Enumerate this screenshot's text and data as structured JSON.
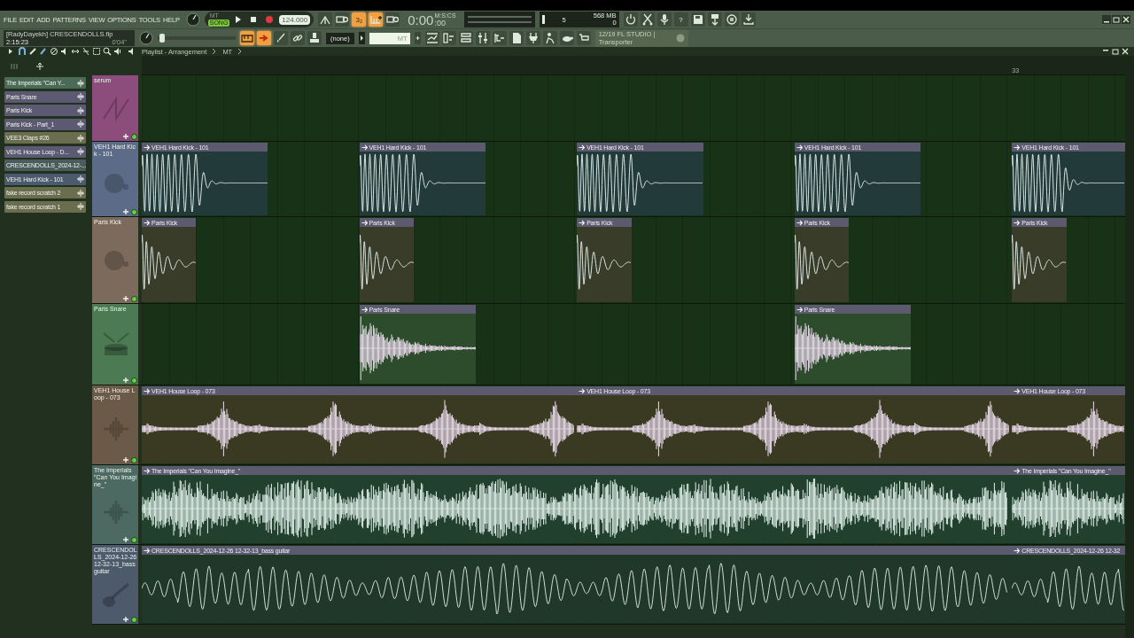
{
  "menu": [
    "FILE",
    "EDIT",
    "ADD",
    "PATTERNS",
    "VIEW",
    "OPTIONS",
    "TOOLS",
    "HELP"
  ],
  "transport": {
    "modes": [
      {
        "label": "MT",
        "selected": false
      },
      {
        "label": "SONG",
        "selected": true
      }
    ],
    "tempo": "124.000"
  },
  "tools_row1": [
    {
      "kind": "metronome",
      "on": false
    },
    {
      "kind": "wait",
      "on": false
    },
    {
      "kind": "countdown",
      "label": "3₂",
      "on": true
    },
    {
      "kind": "blend",
      "on": true
    },
    {
      "kind": "loop-record",
      "on": false
    }
  ],
  "time": {
    "value": "0:00",
    "sub": ":00",
    "unit": "M:S:CS"
  },
  "meter": {
    "cpu": "5",
    "memory": "568 MB",
    "polyphony": "0"
  },
  "tools_row1_right": [
    {
      "kind": "reload"
    },
    {
      "kind": "cut"
    },
    {
      "kind": "mic"
    },
    {
      "kind": "help",
      "label": "?"
    },
    {
      "kind": "save"
    },
    {
      "kind": "export"
    },
    {
      "kind": "chat"
    },
    {
      "kind": "download"
    }
  ],
  "project": {
    "title": "[RadyDayekh] CRESCENDOLLS.flp",
    "time": "2:15:23",
    "length": "0'04\""
  },
  "master_pitch": {
    "level": 0.02
  },
  "tools_row2": [
    {
      "kind": "typing",
      "on": true
    },
    {
      "kind": "step",
      "on": true
    },
    {
      "kind": "brush",
      "on": false
    },
    {
      "kind": "link",
      "on": false
    },
    {
      "kind": "stamp",
      "on": false
    }
  ],
  "pattern": {
    "value": "(none)",
    "name": "MT"
  },
  "tools_row2_right": [
    {
      "kind": "playlist"
    },
    {
      "kind": "piano"
    },
    {
      "kind": "channels"
    },
    {
      "kind": "mixer"
    },
    {
      "kind": "browser"
    },
    {
      "kind": "file"
    },
    {
      "kind": "plugin"
    },
    {
      "kind": "touch"
    },
    {
      "kind": "turtle"
    },
    {
      "kind": "cart"
    }
  ],
  "hint": {
    "line1": "12/19 FL STUDIO |",
    "line2": "Transporter"
  },
  "playlist": {
    "title": "Playlist - Arrangement",
    "pattern": "MT"
  },
  "ruler": [
    {
      "label": "33"
    }
  ],
  "browser": [
    {
      "label": "The Imperials \"Can Y...",
      "color": "#4c6a58"
    },
    {
      "label": "Paris Snare",
      "color": "#5c5a72"
    },
    {
      "label": "Paris Kick",
      "color": "#5c5a72"
    },
    {
      "label": "Paris Kick - Part_1",
      "color": "#5c5a72"
    },
    {
      "label": "VEE3 Claps #26",
      "color": "#6a6e4e"
    },
    {
      "label": "VEH1 House Loop - D...",
      "color": "#5c5a72"
    },
    {
      "label": "CRESCENDOLLS_2024-12-...",
      "color": "#4a5c5c"
    },
    {
      "label": "VEH1 Hard Kick - 101",
      "color": "#4c5a6e"
    },
    {
      "label": "fake record scratch 2",
      "color": "#6a6e4e"
    },
    {
      "label": "fake record scratch 1",
      "color": "#6a6e4e"
    }
  ],
  "tracks": [
    {
      "name": "serum",
      "kind": "synth",
      "color": "#8c4c7c",
      "muted": false
    },
    {
      "name": "VEH1 Hard Kick - 101",
      "kind": "kick",
      "color": "#5c6c88",
      "muted": false,
      "clips": [
        {
          "title": "VEH1 Hard Kick - 101"
        },
        {
          "title": "VEH1 Hard Kick - 101"
        },
        {
          "title": "VEH1 Hard Kick - 101"
        },
        {
          "title": "VEH1 Hard Kick - 101"
        },
        {
          "title": "VEH1 Hard Kick - 101"
        }
      ]
    },
    {
      "name": "Paris Kick",
      "kind": "kick2",
      "color": "#7c6a5c",
      "muted": false,
      "clips": [
        {
          "title": "Paris Kick"
        },
        {
          "title": "Paris Kick"
        },
        {
          "title": "Paris Kick"
        },
        {
          "title": "Paris Kick"
        },
        {
          "title": "Paris Kick"
        }
      ]
    },
    {
      "name": "Paris Snare",
      "kind": "snare",
      "color": "#4c7a52",
      "muted": false,
      "clips": [
        {
          "title": "Paris Snare"
        },
        {
          "title": "Paris Snare"
        }
      ]
    },
    {
      "name": "VEH1 House Loop - 073",
      "kind": "loop",
      "color": "#6c5a48",
      "muted": false,
      "clips": [
        {
          "title": "VEH1 House Loop - 073"
        },
        {
          "title": "VEH1 House Loop - 073"
        },
        {
          "title": "VEH1 House Loop - 073"
        }
      ]
    },
    {
      "name": "The Imperials \"Can You Imagine_\"",
      "kind": "vocal",
      "color": "#4c6a62",
      "muted": false,
      "clips": [
        {
          "title": "The Imperials \"Can You Imagine_\""
        },
        {
          "title": "The Imperials \"Can You Imagine_\""
        }
      ]
    },
    {
      "name": "CRESCENDOLLS_2024-12-26 12-32-13_bass guitar",
      "kind": "bass",
      "color": "#4c5a6c",
      "muted": false,
      "clips": [
        {
          "title": "CRESCENDOLLS_2024-12-26 12-32-13_bass guitar"
        },
        {
          "title": "CRESCENDOLLS_2024-12-26 12-32"
        }
      ]
    }
  ]
}
